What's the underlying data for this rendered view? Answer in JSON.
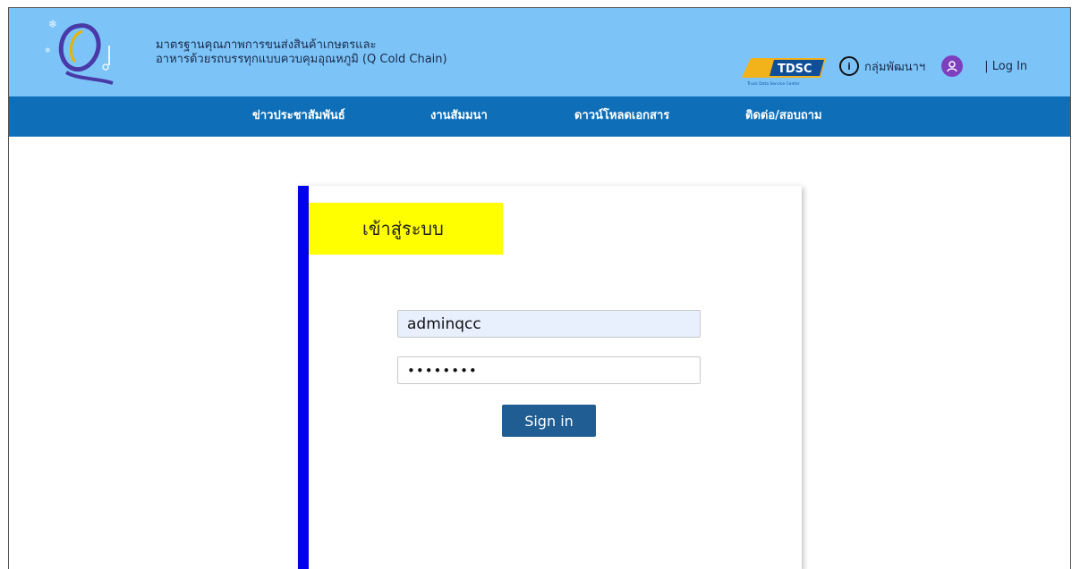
{
  "header": {
    "title_line1": "มาตรฐานคุณภาพการขนส่งสินค้าเกษตรและ",
    "title_line2": "อาหารด้วยรถบรรทุกแบบควบคุมอุณหภูมิ (Q Cold Chain)",
    "partner_logo_text": "TDSC",
    "partner_logo_subtext": "Truck Data Service Center",
    "dev_group_label": "กลุ่มพัฒนาฯ",
    "login_label": "| Log In",
    "icons": {
      "info": "info-icon",
      "user": "user-icon",
      "logo": "q-cold-chain-logo-icon"
    }
  },
  "nav": {
    "items": [
      {
        "label": "ข่าวประชาสัมพันธ์"
      },
      {
        "label": "งานสัมมนา"
      },
      {
        "label": "ดาวน์โหลดเอกสาร"
      },
      {
        "label": "ติดต่อ/สอบถาม"
      }
    ]
  },
  "login": {
    "title": "เข้าสู่ระบบ",
    "username_value": "adminqcc",
    "password_value": "••••••••",
    "signin_label": "Sign in"
  },
  "colors": {
    "header_bg": "#7cc4f8",
    "nav_bg": "#0e6fb8",
    "card_accent": "#0000ee",
    "title_bg": "#ffff00",
    "button_bg": "#1f5d93",
    "user_icon": "#7e3fbf"
  }
}
